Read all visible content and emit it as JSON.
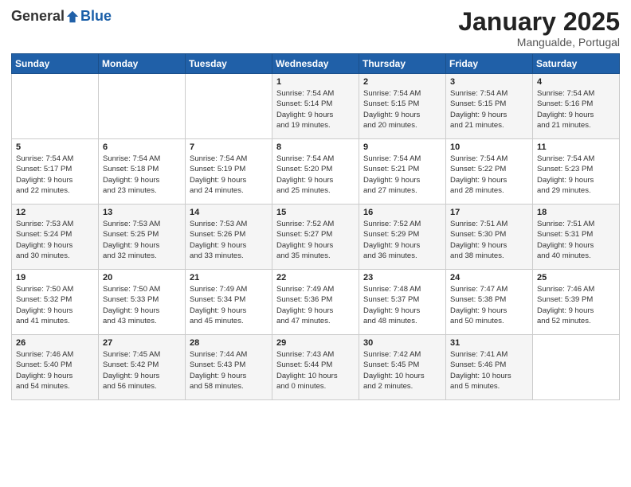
{
  "logo": {
    "general": "General",
    "blue": "Blue"
  },
  "header": {
    "month": "January 2025",
    "location": "Mangualde, Portugal"
  },
  "weekdays": [
    "Sunday",
    "Monday",
    "Tuesday",
    "Wednesday",
    "Thursday",
    "Friday",
    "Saturday"
  ],
  "weeks": [
    [
      {
        "day": "",
        "info": ""
      },
      {
        "day": "",
        "info": ""
      },
      {
        "day": "",
        "info": ""
      },
      {
        "day": "1",
        "info": "Sunrise: 7:54 AM\nSunset: 5:14 PM\nDaylight: 9 hours\nand 19 minutes."
      },
      {
        "day": "2",
        "info": "Sunrise: 7:54 AM\nSunset: 5:15 PM\nDaylight: 9 hours\nand 20 minutes."
      },
      {
        "day": "3",
        "info": "Sunrise: 7:54 AM\nSunset: 5:15 PM\nDaylight: 9 hours\nand 21 minutes."
      },
      {
        "day": "4",
        "info": "Sunrise: 7:54 AM\nSunset: 5:16 PM\nDaylight: 9 hours\nand 21 minutes."
      }
    ],
    [
      {
        "day": "5",
        "info": "Sunrise: 7:54 AM\nSunset: 5:17 PM\nDaylight: 9 hours\nand 22 minutes."
      },
      {
        "day": "6",
        "info": "Sunrise: 7:54 AM\nSunset: 5:18 PM\nDaylight: 9 hours\nand 23 minutes."
      },
      {
        "day": "7",
        "info": "Sunrise: 7:54 AM\nSunset: 5:19 PM\nDaylight: 9 hours\nand 24 minutes."
      },
      {
        "day": "8",
        "info": "Sunrise: 7:54 AM\nSunset: 5:20 PM\nDaylight: 9 hours\nand 25 minutes."
      },
      {
        "day": "9",
        "info": "Sunrise: 7:54 AM\nSunset: 5:21 PM\nDaylight: 9 hours\nand 27 minutes."
      },
      {
        "day": "10",
        "info": "Sunrise: 7:54 AM\nSunset: 5:22 PM\nDaylight: 9 hours\nand 28 minutes."
      },
      {
        "day": "11",
        "info": "Sunrise: 7:54 AM\nSunset: 5:23 PM\nDaylight: 9 hours\nand 29 minutes."
      }
    ],
    [
      {
        "day": "12",
        "info": "Sunrise: 7:53 AM\nSunset: 5:24 PM\nDaylight: 9 hours\nand 30 minutes."
      },
      {
        "day": "13",
        "info": "Sunrise: 7:53 AM\nSunset: 5:25 PM\nDaylight: 9 hours\nand 32 minutes."
      },
      {
        "day": "14",
        "info": "Sunrise: 7:53 AM\nSunset: 5:26 PM\nDaylight: 9 hours\nand 33 minutes."
      },
      {
        "day": "15",
        "info": "Sunrise: 7:52 AM\nSunset: 5:27 PM\nDaylight: 9 hours\nand 35 minutes."
      },
      {
        "day": "16",
        "info": "Sunrise: 7:52 AM\nSunset: 5:29 PM\nDaylight: 9 hours\nand 36 minutes."
      },
      {
        "day": "17",
        "info": "Sunrise: 7:51 AM\nSunset: 5:30 PM\nDaylight: 9 hours\nand 38 minutes."
      },
      {
        "day": "18",
        "info": "Sunrise: 7:51 AM\nSunset: 5:31 PM\nDaylight: 9 hours\nand 40 minutes."
      }
    ],
    [
      {
        "day": "19",
        "info": "Sunrise: 7:50 AM\nSunset: 5:32 PM\nDaylight: 9 hours\nand 41 minutes."
      },
      {
        "day": "20",
        "info": "Sunrise: 7:50 AM\nSunset: 5:33 PM\nDaylight: 9 hours\nand 43 minutes."
      },
      {
        "day": "21",
        "info": "Sunrise: 7:49 AM\nSunset: 5:34 PM\nDaylight: 9 hours\nand 45 minutes."
      },
      {
        "day": "22",
        "info": "Sunrise: 7:49 AM\nSunset: 5:36 PM\nDaylight: 9 hours\nand 47 minutes."
      },
      {
        "day": "23",
        "info": "Sunrise: 7:48 AM\nSunset: 5:37 PM\nDaylight: 9 hours\nand 48 minutes."
      },
      {
        "day": "24",
        "info": "Sunrise: 7:47 AM\nSunset: 5:38 PM\nDaylight: 9 hours\nand 50 minutes."
      },
      {
        "day": "25",
        "info": "Sunrise: 7:46 AM\nSunset: 5:39 PM\nDaylight: 9 hours\nand 52 minutes."
      }
    ],
    [
      {
        "day": "26",
        "info": "Sunrise: 7:46 AM\nSunset: 5:40 PM\nDaylight: 9 hours\nand 54 minutes."
      },
      {
        "day": "27",
        "info": "Sunrise: 7:45 AM\nSunset: 5:42 PM\nDaylight: 9 hours\nand 56 minutes."
      },
      {
        "day": "28",
        "info": "Sunrise: 7:44 AM\nSunset: 5:43 PM\nDaylight: 9 hours\nand 58 minutes."
      },
      {
        "day": "29",
        "info": "Sunrise: 7:43 AM\nSunset: 5:44 PM\nDaylight: 10 hours\nand 0 minutes."
      },
      {
        "day": "30",
        "info": "Sunrise: 7:42 AM\nSunset: 5:45 PM\nDaylight: 10 hours\nand 2 minutes."
      },
      {
        "day": "31",
        "info": "Sunrise: 7:41 AM\nSunset: 5:46 PM\nDaylight: 10 hours\nand 5 minutes."
      },
      {
        "day": "",
        "info": ""
      }
    ]
  ]
}
